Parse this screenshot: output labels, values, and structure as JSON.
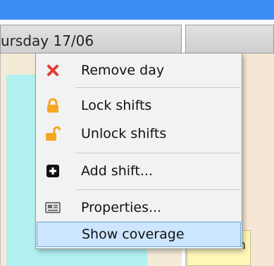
{
  "header": {
    "day_title": "ursday 17/06"
  },
  "calendar": {
    "cell_text": "n"
  },
  "context_menu": {
    "items": [
      {
        "id": "remove-day",
        "label": "Remove day",
        "icon": "close-icon",
        "icon_color": "#e53935"
      },
      {
        "id": "lock-shifts",
        "label": "Lock shifts",
        "icon": "lock-icon",
        "icon_color": "#f5a623"
      },
      {
        "id": "unlock-shifts",
        "label": "Unlock shifts",
        "icon": "unlock-icon",
        "icon_color": "#f5a623"
      },
      {
        "id": "add-shift",
        "label": "Add shift...",
        "icon": "plus-square-icon",
        "icon_color": "#111111"
      },
      {
        "id": "properties",
        "label": "Properties...",
        "icon": "properties-icon",
        "icon_color": "#555555"
      },
      {
        "id": "show-coverage",
        "label": "Show coverage",
        "icon": null,
        "highlighted": true
      }
    ]
  },
  "colors": {
    "topbar": "#3c8ef5",
    "menu_highlight": "#cce6ff",
    "cell_cyan": "#b2f1f1",
    "cell_beige": "#f4ead8",
    "cell_yellow": "#fff7b8"
  }
}
